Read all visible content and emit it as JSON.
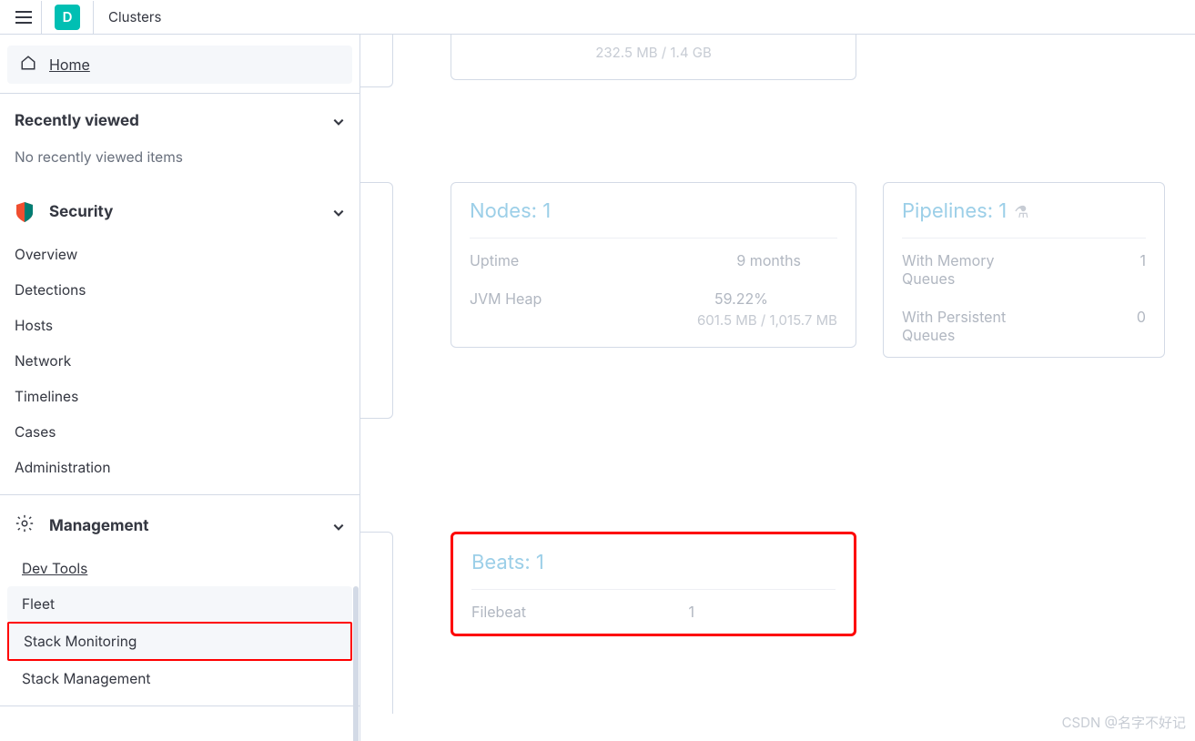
{
  "topbar": {
    "app_badge": "D",
    "breadcrumb": "Clusters"
  },
  "sidebar": {
    "home": "Home",
    "recently_viewed": {
      "title": "Recently viewed",
      "empty": "No recently viewed items"
    },
    "security": {
      "title": "Security",
      "items": [
        "Overview",
        "Detections",
        "Hosts",
        "Network",
        "Timelines",
        "Cases",
        "Administration"
      ]
    },
    "management": {
      "title": "Management",
      "items": [
        "Dev Tools",
        "Fleet",
        "Stack Monitoring",
        "Stack Management"
      ]
    }
  },
  "main": {
    "top_snippet": "232.5 MB / 1.4 GB",
    "nodes": {
      "title": "Nodes: 1",
      "uptime_label": "Uptime",
      "uptime_value": "9 months",
      "jvm_label": "JVM Heap",
      "jvm_pct": "59.22%",
      "jvm_detail": "601.5 MB / 1,015.7 MB"
    },
    "pipelines": {
      "title": "Pipelines: 1",
      "mem_label": "With Memory Queues",
      "mem_value": "1",
      "persist_label": "With Persistent Queues",
      "persist_value": "0"
    },
    "beats": {
      "title": "Beats: 1",
      "filebeat_label": "Filebeat",
      "filebeat_value": "1"
    }
  },
  "watermark": "CSDN @名字不好记"
}
